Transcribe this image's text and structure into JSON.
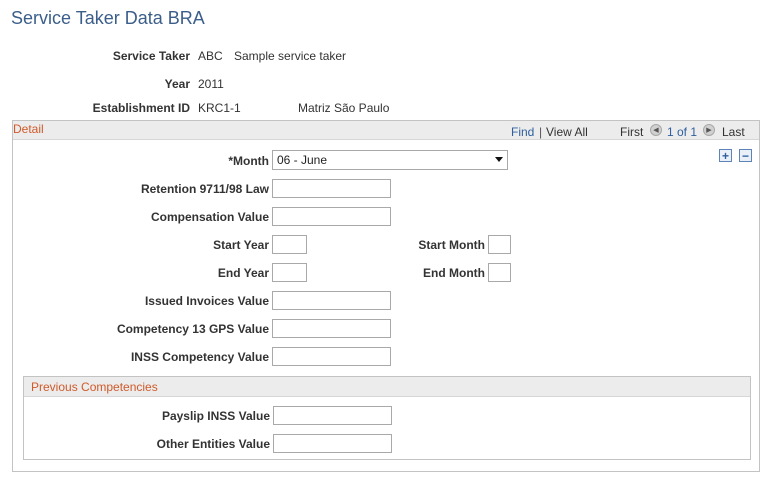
{
  "page": {
    "title": "Service Taker Data BRA"
  },
  "summary": {
    "service_taker_label": "Service Taker",
    "service_taker_code": "ABC",
    "service_taker_desc": "Sample service taker",
    "year_label": "Year",
    "year_value": "2011",
    "establishment_label": "Establishment ID",
    "establishment_code": "KRC1-1",
    "establishment_desc": "Matriz São Paulo"
  },
  "detail": {
    "title": "Detail",
    "nav": {
      "find": "Find",
      "separator": "|",
      "view_all": "View All",
      "first": "First",
      "page_info": "1 of 1",
      "last": "Last"
    },
    "add_symbol": "+",
    "remove_symbol": "−",
    "fields": {
      "month_label": "*Month",
      "month_value": "06 - June",
      "retention_label": "Retention 9711/98 Law",
      "compensation_label": "Compensation Value",
      "start_year_label": "Start Year",
      "start_month_label": "Start Month",
      "end_year_label": "End Year",
      "end_month_label": "End Month",
      "issued_invoices_label": "Issued Invoices Value",
      "competency13_label": "Competency 13 GPS Value",
      "inss_competency_label": "INSS Competency Value"
    },
    "previous": {
      "title": "Previous Competencies",
      "payslip_label": "Payslip INSS Value",
      "other_entities_label": "Other Entities Value"
    }
  }
}
